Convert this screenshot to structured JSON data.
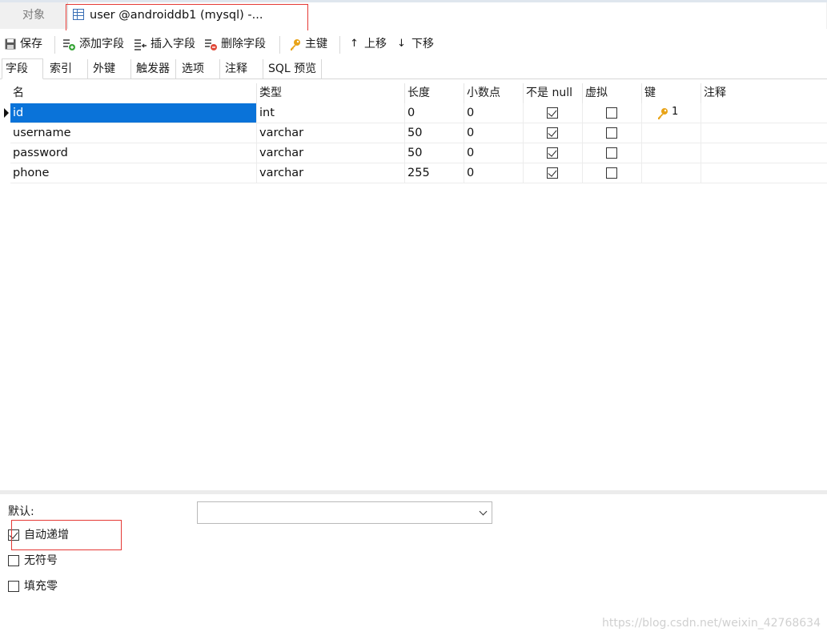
{
  "tabs": {
    "objects_label": "对象",
    "active_label": "user @androiddb1 (mysql) -..."
  },
  "toolbar": {
    "save": "保存",
    "add_field": "添加字段",
    "insert_field": "插入字段",
    "delete_field": "删除字段",
    "primary_key": "主键",
    "move_up": "上移",
    "move_down": "下移"
  },
  "subtabs": [
    "字段",
    "索引",
    "外键",
    "触发器",
    "选项",
    "注释",
    "SQL 预览"
  ],
  "grid": {
    "columns": [
      "名",
      "类型",
      "长度",
      "小数点",
      "不是 null",
      "虚拟",
      "键",
      "注释"
    ],
    "rows": [
      {
        "name": "id",
        "type": "int",
        "length": "0",
        "decimals": "0",
        "not_null": true,
        "virtual": false,
        "key": "1",
        "comment": ""
      },
      {
        "name": "username",
        "type": "varchar",
        "length": "50",
        "decimals": "0",
        "not_null": true,
        "virtual": false,
        "key": "",
        "comment": ""
      },
      {
        "name": "password",
        "type": "varchar",
        "length": "50",
        "decimals": "0",
        "not_null": true,
        "virtual": false,
        "key": "",
        "comment": ""
      },
      {
        "name": "phone",
        "type": "varchar",
        "length": "255",
        "decimals": "0",
        "not_null": true,
        "virtual": false,
        "key": "",
        "comment": ""
      }
    ]
  },
  "properties": {
    "default_label": "默认:",
    "default_value": "",
    "options": [
      {
        "label": "自动递增",
        "checked": true
      },
      {
        "label": "无符号",
        "checked": false
      },
      {
        "label": "填充零",
        "checked": false
      }
    ]
  },
  "watermark": "https://blog.csdn.net/weixin_42768634",
  "colors": {
    "selection": "#0a73d9",
    "highlight_box": "#e53935",
    "key_icon": "#e8a317"
  }
}
